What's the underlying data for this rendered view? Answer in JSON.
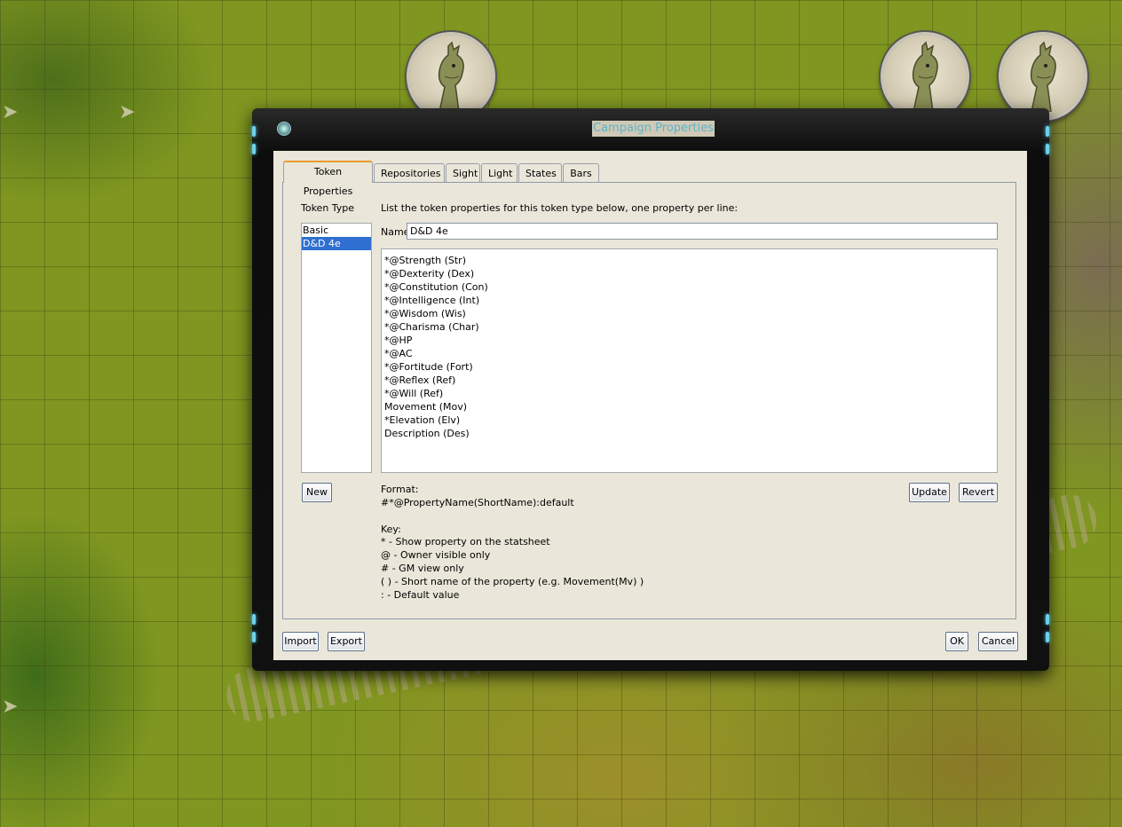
{
  "window": {
    "title": "Campaign Properties"
  },
  "tabs": [
    {
      "label": "Token Properties",
      "active": true
    },
    {
      "label": "Repositories"
    },
    {
      "label": "Sight"
    },
    {
      "label": "Light"
    },
    {
      "label": "States"
    },
    {
      "label": "Bars"
    }
  ],
  "token_type": {
    "label": "Token Type",
    "items": [
      {
        "label": "Basic",
        "selected": false
      },
      {
        "label": "D&D 4e",
        "selected": true
      }
    ],
    "new_button": "New"
  },
  "editor": {
    "instruction": "List the token properties for this token type below, one property per line:",
    "name_label": "Name:",
    "name_value": "D&D 4e",
    "properties": [
      "*@Strength (Str)",
      "*@Dexterity (Dex)",
      "*@Constitution (Con)",
      "*@Intelligence (Int)",
      "*@Wisdom (Wis)",
      "*@Charisma (Char)",
      "*@HP",
      "*@AC",
      "*@Fortitude (Fort)",
      "*@Reflex (Ref)",
      "*@Will (Ref)",
      "Movement (Mov)",
      "*Elevation (Elv)",
      "Description (Des)"
    ],
    "update_button": "Update",
    "revert_button": "Revert"
  },
  "help": {
    "format_label": "Format:",
    "format_value": "#*@PropertyName(ShortName):default",
    "key_label": "Key:",
    "key_lines": [
      "* - Show property on the statsheet",
      "@ - Owner visible only",
      "# - GM view only",
      "( ) - Short name of the property (e.g. Movement(Mv) )",
      ": - Default value"
    ]
  },
  "footer": {
    "import_button": "Import",
    "export_button": "Export",
    "ok_button": "OK",
    "cancel_button": "Cancel"
  },
  "colors": {
    "title_text": "#5fb3c6",
    "dialog_bg": "#eae7da",
    "selection": "#2f6fd1",
    "active_tab_accent": "#e89a2a"
  }
}
